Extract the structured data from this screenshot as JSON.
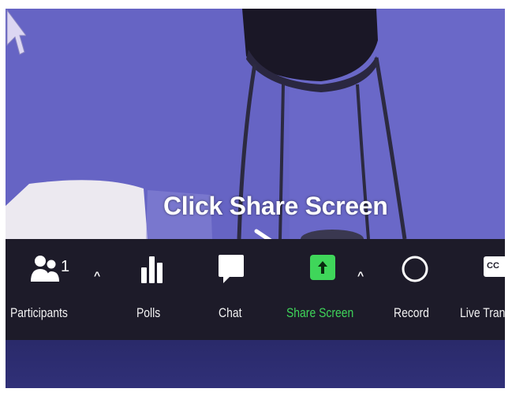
{
  "annotation": {
    "text": "Click Share Screen"
  },
  "toolbar": {
    "participants": {
      "label": "Participants",
      "count": "1",
      "caret": "^"
    },
    "polls": {
      "label": "Polls"
    },
    "chat": {
      "label": "Chat"
    },
    "share_screen": {
      "label": "Share Screen",
      "caret": "^",
      "accent": "#3fd65a"
    },
    "record": {
      "label": "Record"
    },
    "live_transcript": {
      "label": "Live Trans",
      "badge": "CC"
    }
  },
  "icons": [
    "participants-icon",
    "polls-icon",
    "chat-icon",
    "share-screen-icon",
    "record-icon",
    "cc-icon",
    "mouse-cursor-icon"
  ]
}
